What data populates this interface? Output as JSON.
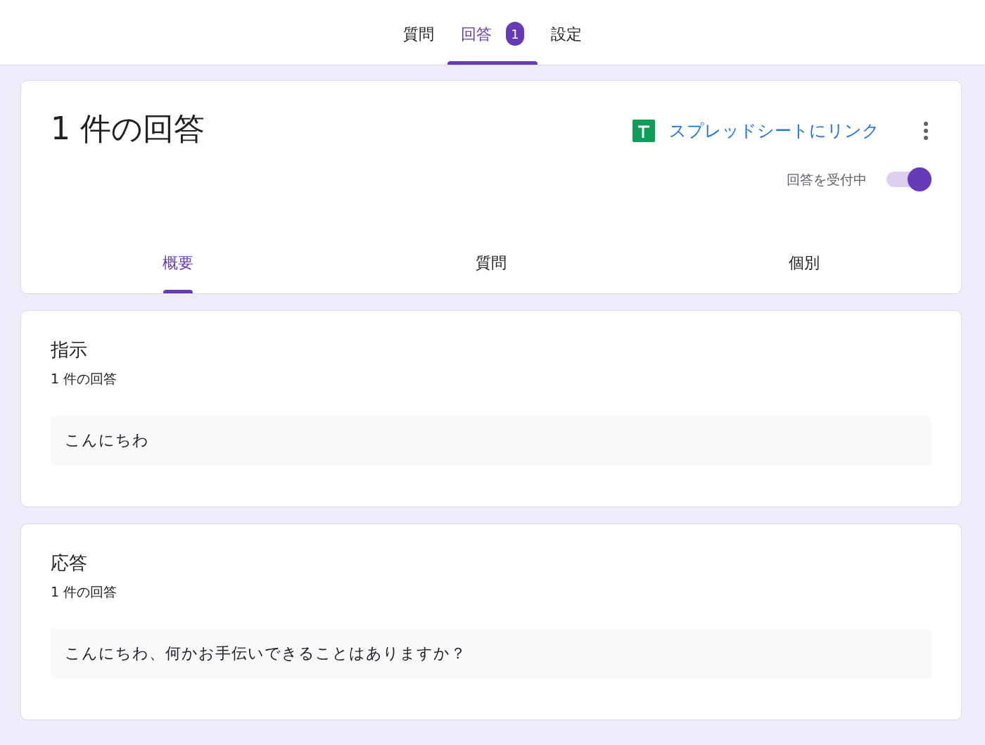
{
  "top_tabs": [
    {
      "label": "質問",
      "selected": false
    },
    {
      "label": "回答",
      "selected": true,
      "badge": "1"
    },
    {
      "label": "設定",
      "selected": false
    }
  ],
  "summary": {
    "title": "1 件の回答",
    "sheet_link": "スプレッドシートにリンク",
    "accepting": {
      "label": "回答を受付中",
      "on": true
    },
    "tabs": [
      {
        "label": "概要",
        "selected": true
      },
      {
        "label": "質問",
        "selected": false
      },
      {
        "label": "個別",
        "selected": false
      }
    ]
  },
  "questions": [
    {
      "title": "指示",
      "count": "1 件の回答",
      "answers": [
        "こんにちわ"
      ]
    },
    {
      "title": "応答",
      "count": "1 件の回答",
      "answers": [
        "こんにちわ、何かお手伝いできることはありますか？"
      ]
    }
  ]
}
